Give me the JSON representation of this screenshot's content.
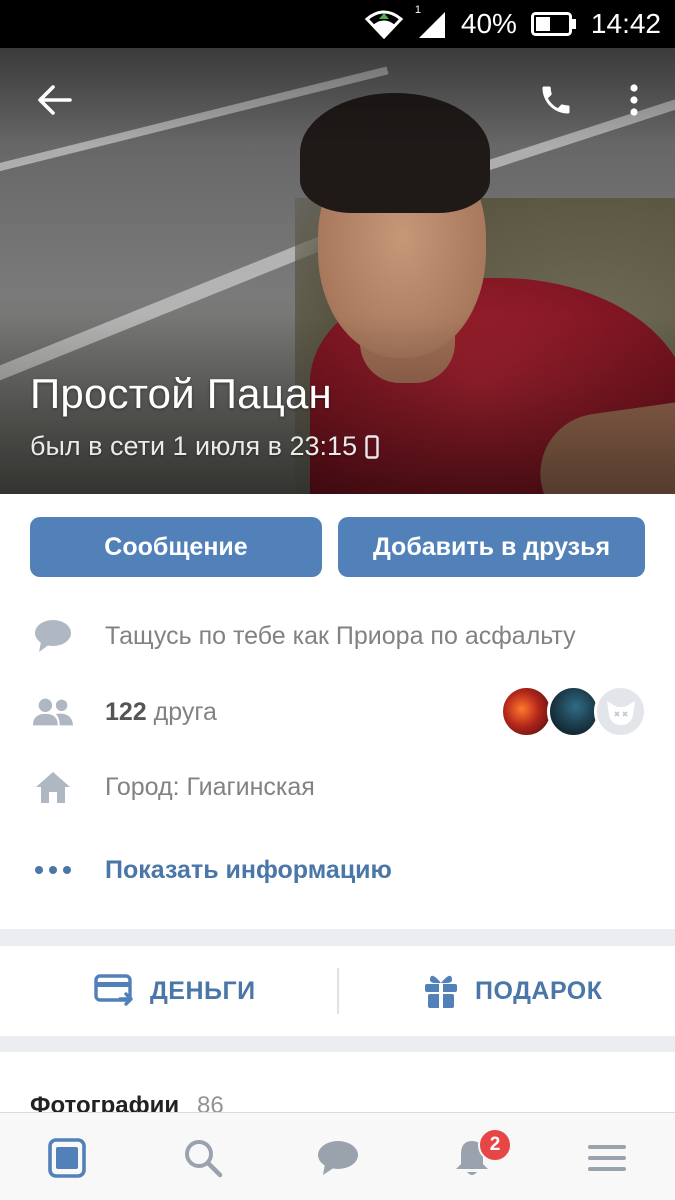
{
  "status_bar": {
    "battery": "40%",
    "time": "14:42",
    "signal_marker": "1"
  },
  "header": {
    "back_icon": "arrow-left-icon",
    "call_icon": "phone-icon",
    "more_icon": "more-vertical-icon",
    "name": "Простой Пацан",
    "last_seen": "был в сети 1 июля в 23:15",
    "device_icon": "mobile-phone-icon"
  },
  "actions": {
    "message_label": "Сообщение",
    "add_friend_label": "Добавить в друзья"
  },
  "info": {
    "status_text": "Тащусь по тебе как Приора по асфальту",
    "friends_count": "122",
    "friends_word": "друга",
    "city": "Город: Гиагинская",
    "show_info_label": "Показать информацию"
  },
  "money": {
    "money_label": "ДЕНЬГИ",
    "gift_label": "ПОДАРОК"
  },
  "photos": {
    "title": "Фотографии",
    "count": "86"
  },
  "bottom_nav": {
    "items": [
      "home-icon",
      "search-icon",
      "messages-icon",
      "bell-icon",
      "menu-icon"
    ],
    "notification_badge": "2"
  },
  "colors": {
    "accent": "#5181b8",
    "link": "#4a76a8",
    "badge": "#e64646"
  }
}
